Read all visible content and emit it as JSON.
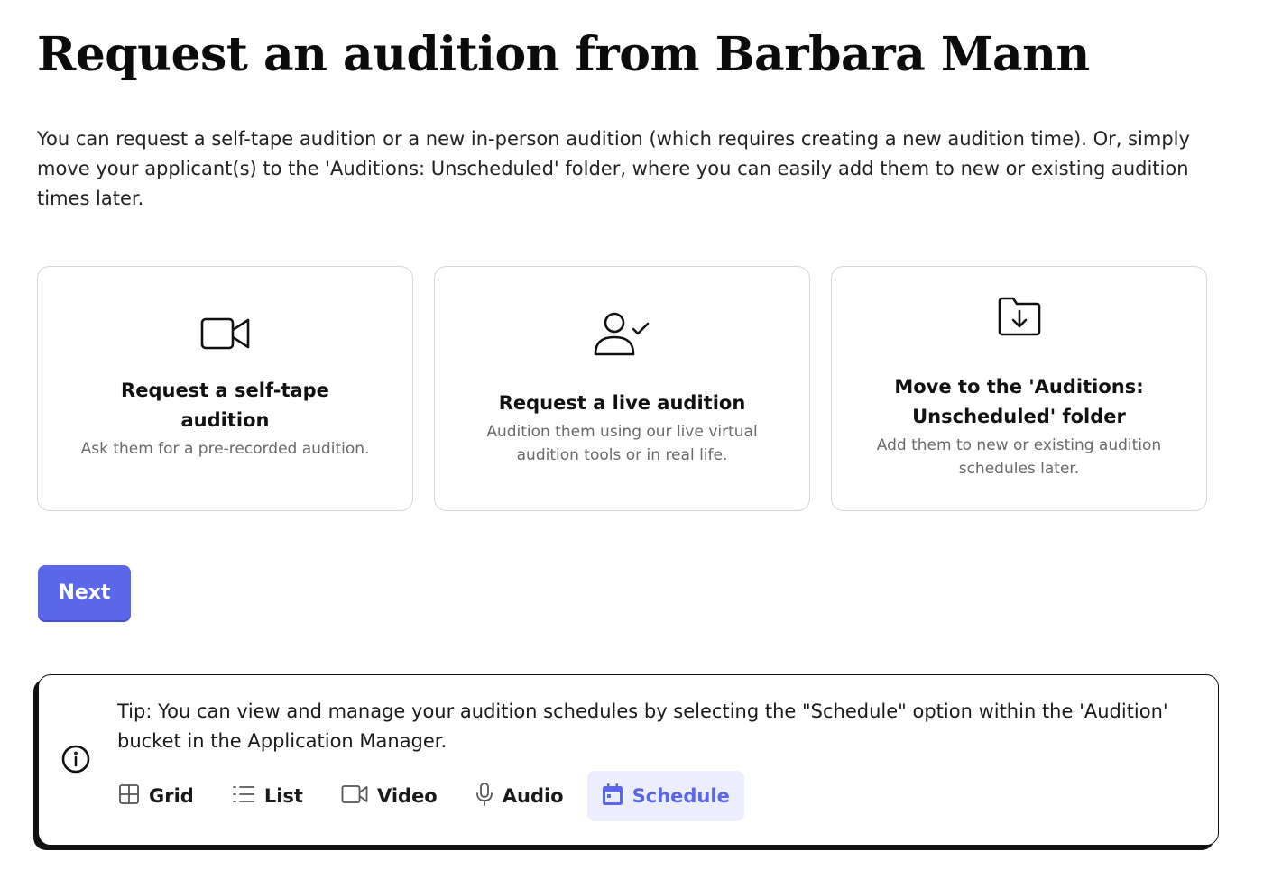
{
  "header": {
    "title": "Request an audition from Barbara Mann",
    "intro": "You can request a self-tape audition or a new in-person audition (which requires creating a new audition time). Or, simply move your applicant(s) to the 'Auditions: Unscheduled' folder, where you can easily add them to new or existing audition times later."
  },
  "options": [
    {
      "icon": "video-camera-icon",
      "title": "Request a self-tape audition",
      "description": "Ask them for a pre-recorded audition."
    },
    {
      "icon": "user-check-icon",
      "title": "Request a live audition",
      "description": "Audition them using our live virtual audition tools or in real life."
    },
    {
      "icon": "folder-download-icon",
      "title": "Move to the 'Auditions: Unscheduled' folder",
      "description": "Add them to new or existing audition schedules later."
    }
  ],
  "actions": {
    "next_label": "Next"
  },
  "tip": {
    "icon": "info-icon",
    "text": "Tip: You can view and manage your audition schedules by selecting the \"Schedule\" option within the 'Audition' bucket in the Application Manager.",
    "views": [
      {
        "label": "Grid",
        "icon": "grid-icon",
        "active": false
      },
      {
        "label": "List",
        "icon": "list-icon",
        "active": false
      },
      {
        "label": "Video",
        "icon": "video-icon",
        "active": false
      },
      {
        "label": "Audio",
        "icon": "microphone-icon",
        "active": false
      },
      {
        "label": "Schedule",
        "icon": "calendar-icon",
        "active": true
      }
    ]
  },
  "colors": {
    "accent": "#5a67e8",
    "accent_light": "#eceefe",
    "card_border": "#d6d6d9",
    "muted_text": "#6a6a6e"
  }
}
